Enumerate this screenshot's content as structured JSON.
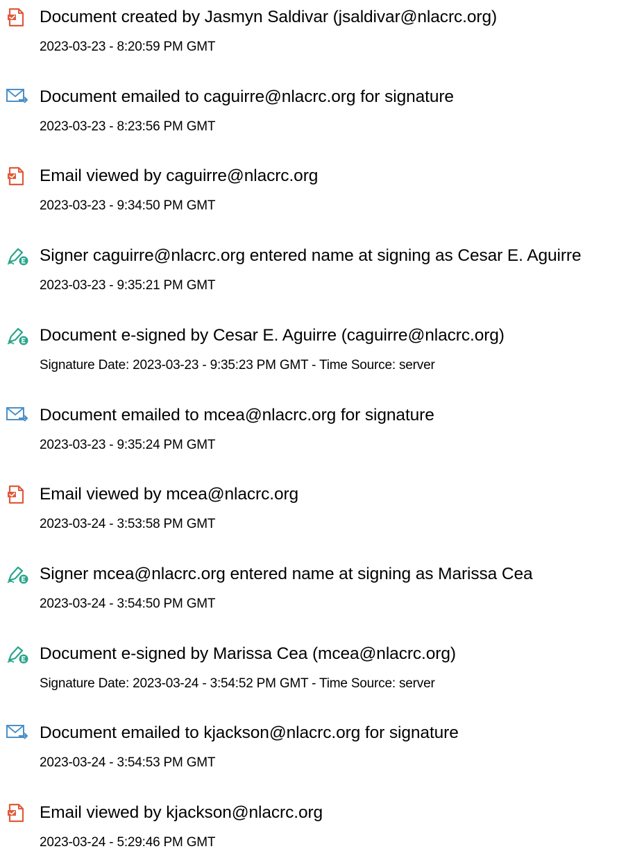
{
  "colors": {
    "document_icon": "#e05a3a",
    "email_icon": "#4a90c8",
    "sign_icon": "#2aa58a"
  },
  "events": [
    {
      "icon": "document-icon",
      "title": "Document created by Jasmyn Saldivar (jsaldivar@nlacrc.org)",
      "detail": "2023-03-23 - 8:20:59 PM GMT"
    },
    {
      "icon": "email-sent-icon",
      "title": "Document emailed to caguirre@nlacrc.org for signature",
      "detail": "2023-03-23 - 8:23:56 PM GMT"
    },
    {
      "icon": "document-icon",
      "title": "Email viewed by caguirre@nlacrc.org",
      "detail": "2023-03-23 - 9:34:50 PM GMT"
    },
    {
      "icon": "e-sign-pen-icon",
      "title": "Signer caguirre@nlacrc.org entered name at signing as Cesar E. Aguirre",
      "detail": "2023-03-23 - 9:35:21 PM GMT"
    },
    {
      "icon": "e-sign-pen-icon",
      "title": "Document e-signed by Cesar E. Aguirre (caguirre@nlacrc.org)",
      "detail": "Signature Date: 2023-03-23 - 9:35:23 PM GMT - Time Source: server"
    },
    {
      "icon": "email-sent-icon",
      "title": "Document emailed to mcea@nlacrc.org for signature",
      "detail": "2023-03-23 - 9:35:24 PM GMT"
    },
    {
      "icon": "document-icon",
      "title": "Email viewed by mcea@nlacrc.org",
      "detail": "2023-03-24 - 3:53:58 PM GMT"
    },
    {
      "icon": "e-sign-pen-icon",
      "title": "Signer mcea@nlacrc.org entered name at signing as Marissa Cea",
      "detail": "2023-03-24 - 3:54:50 PM GMT"
    },
    {
      "icon": "e-sign-pen-icon",
      "title": "Document e-signed by Marissa Cea (mcea@nlacrc.org)",
      "detail": "Signature Date: 2023-03-24 - 3:54:52 PM GMT - Time Source: server"
    },
    {
      "icon": "email-sent-icon",
      "title": "Document emailed to kjackson@nlacrc.org for signature",
      "detail": "2023-03-24 - 3:54:53 PM GMT"
    },
    {
      "icon": "document-icon",
      "title": "Email viewed by kjackson@nlacrc.org",
      "detail": "2023-03-24 - 5:29:46 PM GMT"
    }
  ]
}
